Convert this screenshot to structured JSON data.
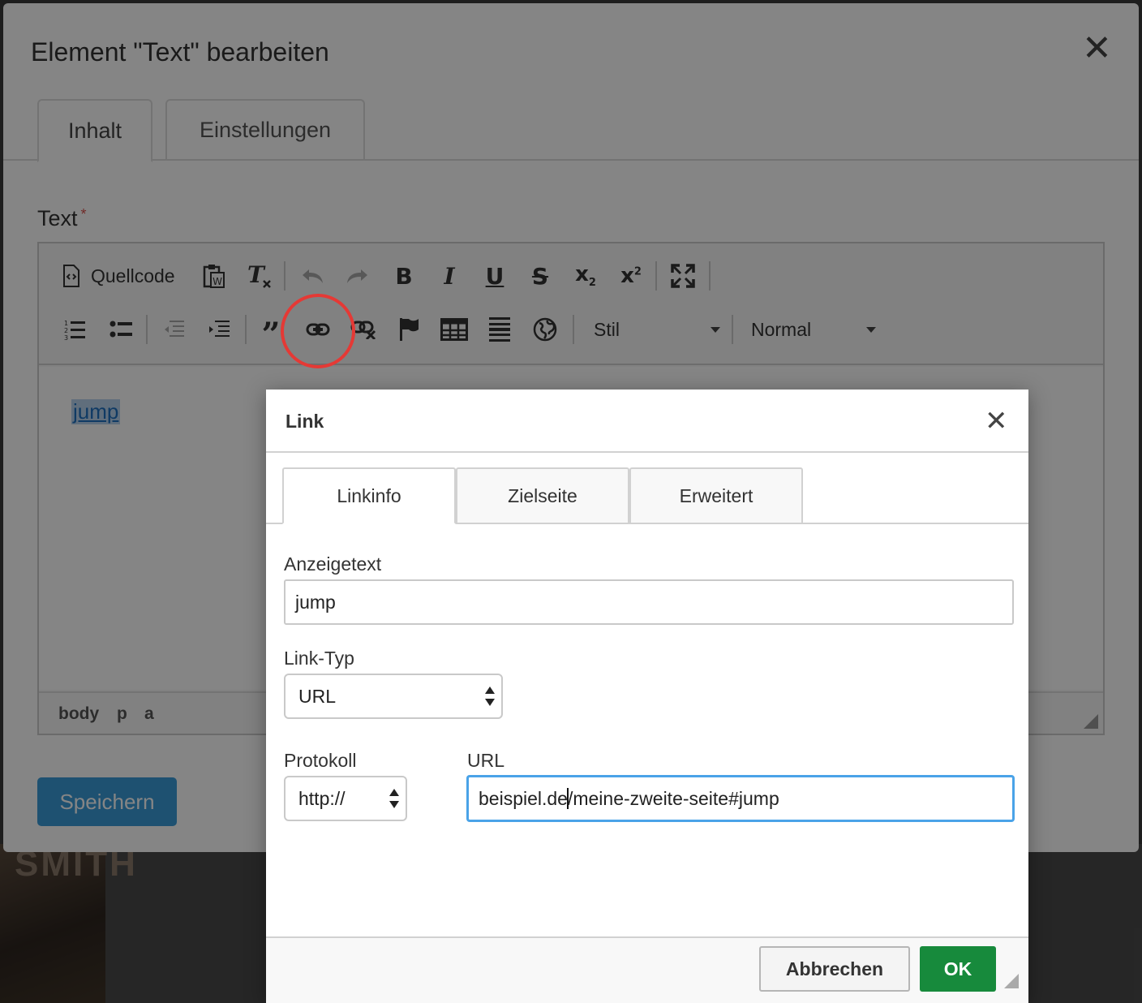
{
  "background": {
    "photo_text": "SMITH"
  },
  "modal": {
    "title": "Element \"Text\" bearbeiten",
    "tabs": [
      "Inhalt",
      "Einstellungen"
    ],
    "field_label": "Text",
    "required_mark": "*",
    "save_label": "Speichern"
  },
  "editor": {
    "toolbar": {
      "source_label": "Quellcode",
      "style_label": "Stil",
      "format_label": "Normal",
      "row1_icons": [
        "source-icon",
        "paste-from-word-icon",
        "remove-format-icon",
        "undo-icon",
        "redo-icon",
        "bold-icon",
        "italic-icon",
        "underline-icon",
        "strikethrough-icon",
        "subscript-icon",
        "superscript-icon",
        "maximize-icon"
      ],
      "row2_icons": [
        "numbered-list-icon",
        "bulleted-list-icon",
        "decrease-indent-icon",
        "increase-indent-icon",
        "blockquote-icon",
        "link-icon",
        "unlink-icon",
        "anchor-icon",
        "table-icon",
        "horizontal-rule-icon",
        "globe-icon"
      ]
    },
    "content_text": "jump",
    "path": [
      "body",
      "p",
      "a"
    ]
  },
  "link_dialog": {
    "title": "Link",
    "tabs": [
      "Linkinfo",
      "Zielseite",
      "Erweitert"
    ],
    "display_text_label": "Anzeigetext",
    "display_text_value": "jump",
    "link_type_label": "Link-Typ",
    "link_type_value": "URL",
    "protocol_label": "Protokoll",
    "protocol_value": "http://",
    "url_label": "URL",
    "url_value_before_cursor": "beispiel.de",
    "url_value_after_cursor": "/meine-zweite-seite#jump",
    "cancel_label": "Abbrechen",
    "ok_label": "OK"
  },
  "colors": {
    "primary": "#3b9cd9",
    "ok": "#178a3c",
    "annotation": "#e53935",
    "link": "#1e70c0"
  }
}
